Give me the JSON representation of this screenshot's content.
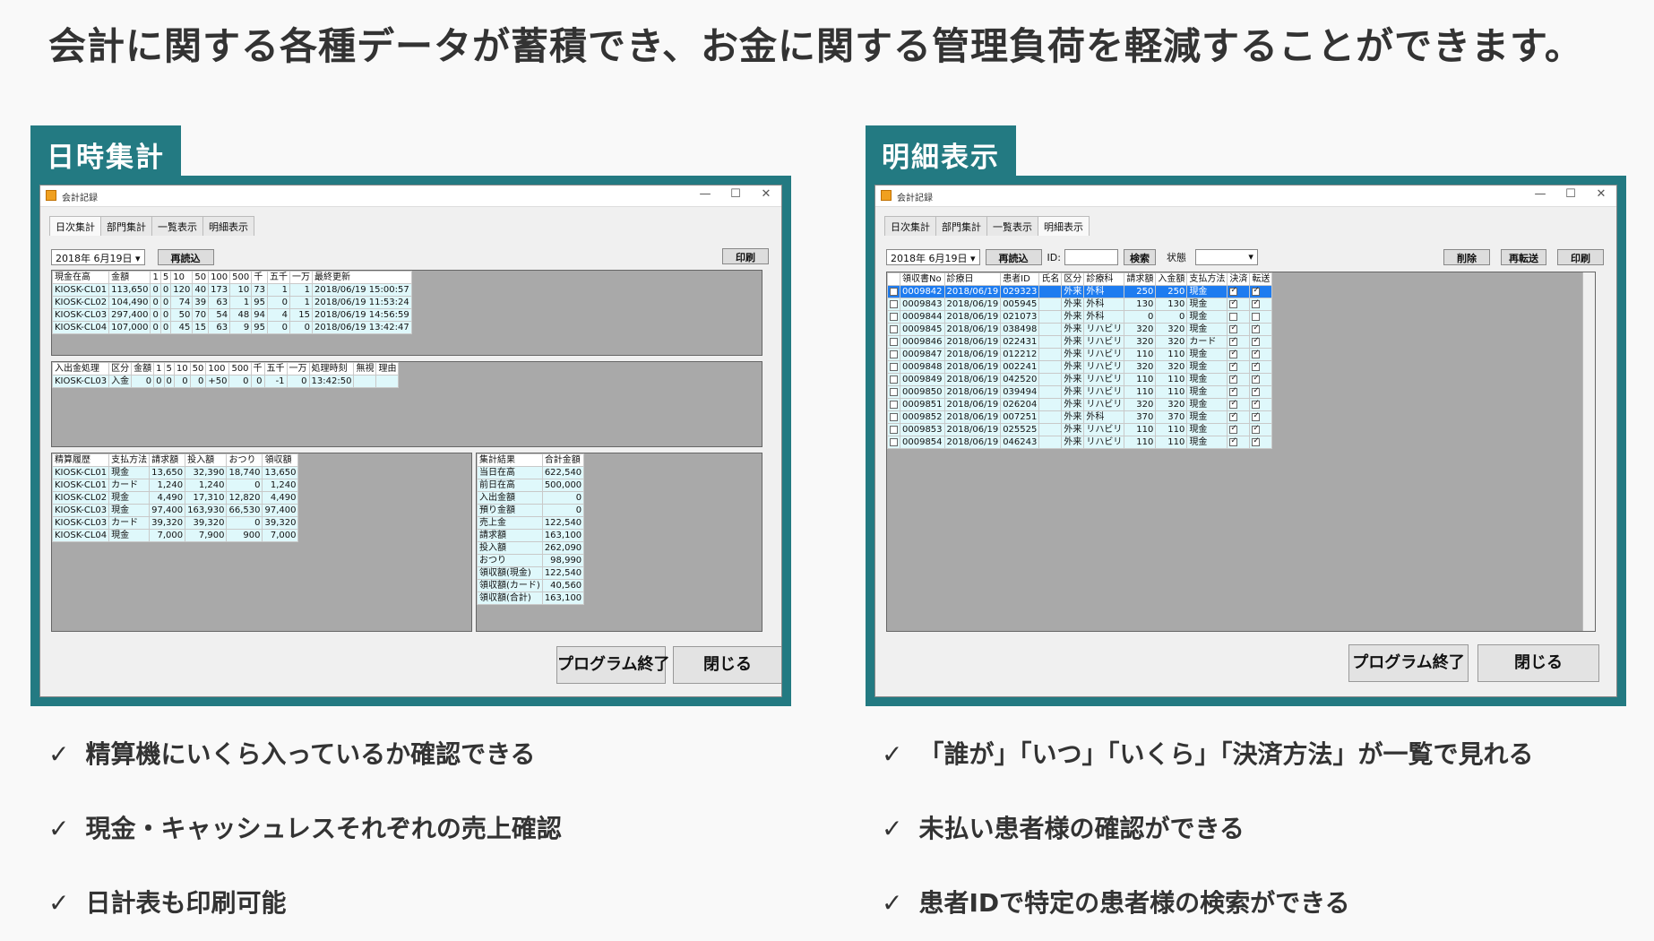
{
  "headline": "会計に関する各種データが蓄積でき、お金に関する管理負荷を軽減することができます。",
  "left": {
    "tag": "日時集計",
    "window_title": "会計記録",
    "controls": [
      "—",
      "☐",
      "✕"
    ],
    "tabs": [
      "日次集計",
      "部門集計",
      "一覧表示",
      "明細表示"
    ],
    "date": "2018年 6月19日",
    "reload": "再読込",
    "print": "印刷",
    "cash_headers": [
      "現金在高",
      "金額",
      "1",
      "5",
      "10",
      "50",
      "100",
      "500",
      "千",
      "五千",
      "一万",
      "最終更新"
    ],
    "cash_rows": [
      [
        "KIOSK-CL01",
        "113,650",
        "0",
        "0",
        "120",
        "40",
        "173",
        "10",
        "73",
        "1",
        "1",
        "2018/06/19 15:00:57"
      ],
      [
        "KIOSK-CL02",
        "104,490",
        "0",
        "0",
        "74",
        "39",
        "63",
        "1",
        "95",
        "0",
        "1",
        "2018/06/19 11:53:24"
      ],
      [
        "KIOSK-CL03",
        "297,400",
        "0",
        "0",
        "50",
        "70",
        "54",
        "48",
        "94",
        "4",
        "15",
        "2018/06/19 14:56:59"
      ],
      [
        "KIOSK-CL04",
        "107,000",
        "0",
        "0",
        "45",
        "15",
        "63",
        "9",
        "95",
        "0",
        "0",
        "2018/06/19 13:42:47"
      ]
    ],
    "io_headers": [
      "入出金処理",
      "区分",
      "金額",
      "1",
      "5",
      "10",
      "50",
      "100",
      "500",
      "千",
      "五千",
      "一万",
      "処理時刻",
      "無視",
      "理由"
    ],
    "io_rows": [
      [
        "KIOSK-CL03",
        "入金",
        "0",
        "0",
        "0",
        "0",
        "0",
        "+50",
        "0",
        "0",
        "-1",
        "0",
        "13:42:50",
        "",
        ""
      ]
    ],
    "settle_headers": [
      "精算履歴",
      "支払方法",
      "請求額",
      "投入額",
      "おつり",
      "領収額"
    ],
    "settle_rows": [
      [
        "KIOSK-CL01",
        "現金",
        "13,650",
        "32,390",
        "18,740",
        "13,650"
      ],
      [
        "KIOSK-CL01",
        "カード",
        "1,240",
        "1,240",
        "0",
        "1,240"
      ],
      [
        "KIOSK-CL02",
        "現金",
        "4,490",
        "17,310",
        "12,820",
        "4,490"
      ],
      [
        "KIOSK-CL03",
        "現金",
        "97,400",
        "163,930",
        "66,530",
        "97,400"
      ],
      [
        "KIOSK-CL03",
        "カード",
        "39,320",
        "39,320",
        "0",
        "39,320"
      ],
      [
        "KIOSK-CL04",
        "現金",
        "7,000",
        "7,900",
        "900",
        "7,000"
      ]
    ],
    "sum_headers": [
      "集計結果",
      "合計金額"
    ],
    "sum_rows": [
      [
        "当日在高",
        "622,540"
      ],
      [
        "前日在高",
        "500,000"
      ],
      [
        "入出金額",
        "0"
      ],
      [
        "預り金額",
        "0"
      ],
      [
        "売上金",
        "122,540"
      ],
      [
        "請求額",
        "163,100"
      ],
      [
        "投入額",
        "262,090"
      ],
      [
        "おつり",
        "98,990"
      ],
      [
        "領収額(現金)",
        "122,540"
      ],
      [
        "領収額(カード)",
        "40,560"
      ],
      [
        "領収額(合計)",
        "163,100"
      ]
    ],
    "btn_exit": "プログラム終了",
    "btn_close": "閉じる"
  },
  "right": {
    "tag": "明細表示",
    "window_title": "会計記録",
    "controls": [
      "—",
      "☐",
      "✕"
    ],
    "tabs": [
      "日次集計",
      "部門集計",
      "一覧表示",
      "明細表示"
    ],
    "date": "2018年 6月19日",
    "reload": "再読込",
    "id_label": "ID:",
    "id_value": "",
    "search": "検索",
    "status_label": "状態",
    "status_value": "",
    "delete": "削除",
    "retransfer": "再転送",
    "print": "印刷",
    "headers": [
      "",
      "領収書No",
      "診療日",
      "患者ID",
      "氏名",
      "区分",
      "診療科",
      "請求額",
      "入金額",
      "支払方法",
      "決済",
      "転送"
    ],
    "rows": [
      [
        "0009842",
        "2018/06/19",
        "029323",
        "",
        "外来",
        "外科",
        "250",
        "250",
        "現金",
        true,
        true
      ],
      [
        "0009843",
        "2018/06/19",
        "005945",
        "",
        "外来",
        "外科",
        "130",
        "130",
        "現金",
        true,
        true
      ],
      [
        "0009844",
        "2018/06/19",
        "021073",
        "",
        "外来",
        "外科",
        "0",
        "0",
        "現金",
        false,
        false
      ],
      [
        "0009845",
        "2018/06/19",
        "038498",
        "",
        "外来",
        "リハビリ",
        "320",
        "320",
        "現金",
        true,
        true
      ],
      [
        "0009846",
        "2018/06/19",
        "022431",
        "",
        "外来",
        "リハビリ",
        "320",
        "320",
        "カード",
        true,
        true
      ],
      [
        "0009847",
        "2018/06/19",
        "012212",
        "",
        "外来",
        "リハビリ",
        "110",
        "110",
        "現金",
        true,
        true
      ],
      [
        "0009848",
        "2018/06/19",
        "002241",
        "",
        "外来",
        "リハビリ",
        "320",
        "320",
        "現金",
        true,
        true
      ],
      [
        "0009849",
        "2018/06/19",
        "042520",
        "",
        "外来",
        "リハビリ",
        "110",
        "110",
        "現金",
        true,
        true
      ],
      [
        "0009850",
        "2018/06/19",
        "039494",
        "",
        "外来",
        "リハビリ",
        "110",
        "110",
        "現金",
        true,
        true
      ],
      [
        "0009851",
        "2018/06/19",
        "026204",
        "",
        "外来",
        "リハビリ",
        "320",
        "320",
        "現金",
        true,
        true
      ],
      [
        "0009852",
        "2018/06/19",
        "007251",
        "",
        "外来",
        "外科",
        "370",
        "370",
        "現金",
        true,
        true
      ],
      [
        "0009853",
        "2018/06/19",
        "025525",
        "",
        "外来",
        "リハビリ",
        "110",
        "110",
        "現金",
        true,
        true
      ],
      [
        "0009854",
        "2018/06/19",
        "046243",
        "",
        "外来",
        "リハビリ",
        "110",
        "110",
        "現金",
        true,
        true
      ]
    ],
    "btn_exit": "プログラム終了",
    "btn_close": "閉じる"
  },
  "left_checks": [
    "精算機にいくら入っているか確認できる",
    "現金・キャッシュレスそれぞれの売上確認",
    "日計表も印刷可能"
  ],
  "right_checks": [
    "「誰が」「いつ」「いくら」「決済方法」が一覧で見れる",
    "未払い患者様の確認ができる",
    "患者IDで特定の患者様の検索ができる"
  ],
  "check_mark": "✓"
}
